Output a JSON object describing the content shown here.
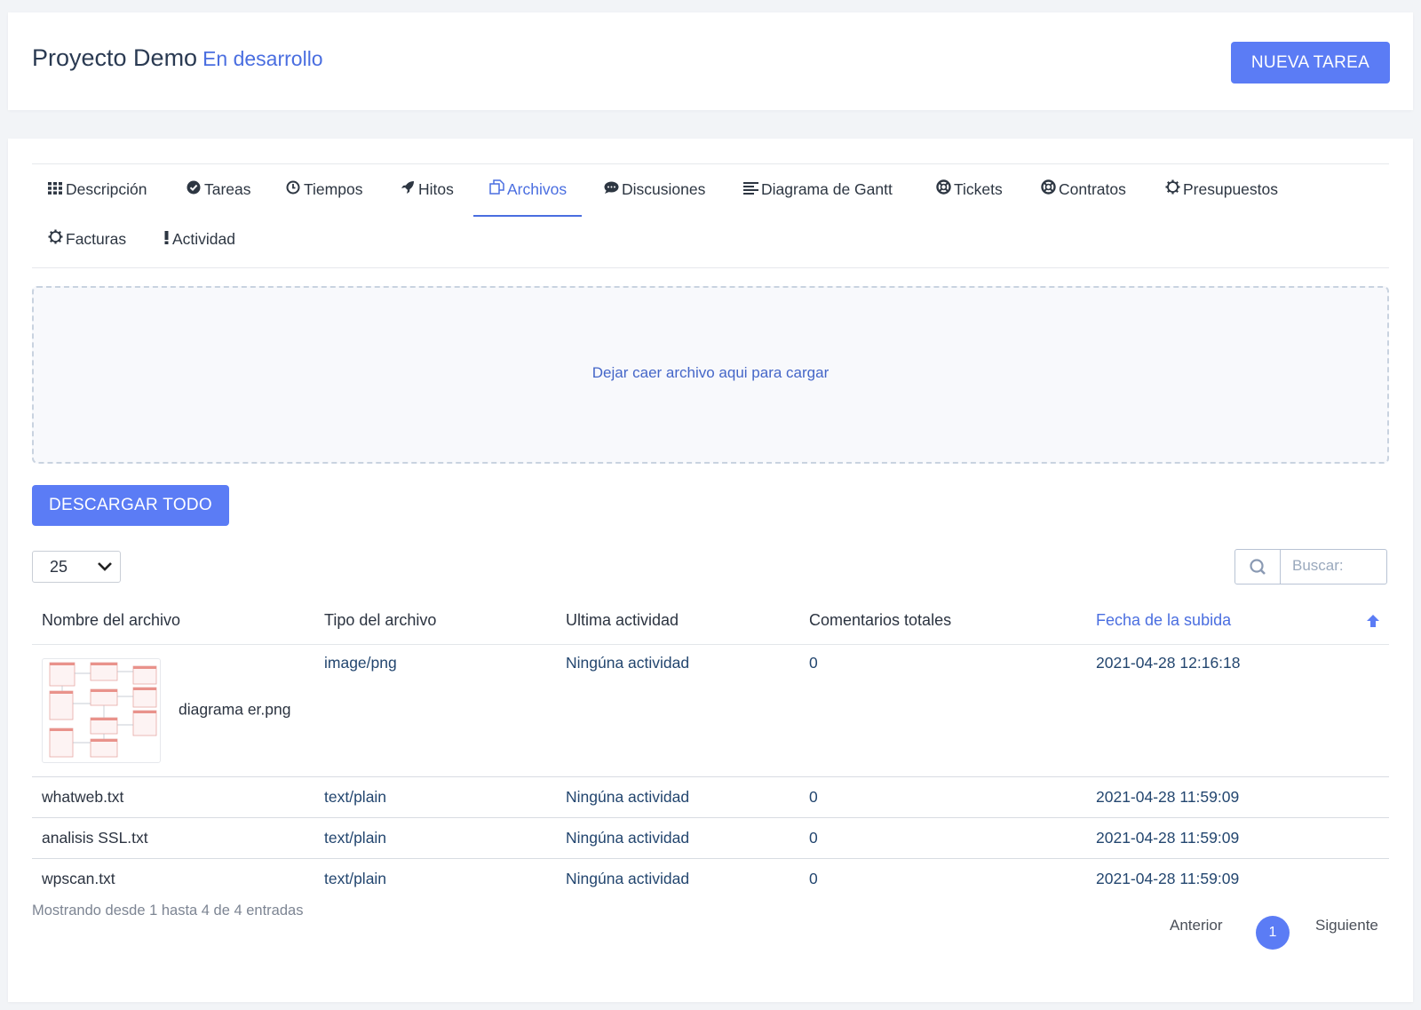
{
  "header": {
    "title": "Proyecto Demo",
    "status": "En desarrollo",
    "new_task_label": "NUEVA TAREA"
  },
  "tabs": [
    {
      "label": "Descripción",
      "icon": "grid-icon"
    },
    {
      "label": "Tareas",
      "icon": "check-circle-icon"
    },
    {
      "label": "Tiempos",
      "icon": "clock-icon"
    },
    {
      "label": "Hitos",
      "icon": "rocket-icon"
    },
    {
      "label": "Archivos",
      "icon": "files-icon",
      "active": true
    },
    {
      "label": "Discusiones",
      "icon": "comment-icon"
    },
    {
      "label": "Diagrama de Gantt",
      "icon": "align-left-icon"
    },
    {
      "label": "Tickets",
      "icon": "life-ring-icon"
    },
    {
      "label": "Contratos",
      "icon": "life-ring-icon"
    },
    {
      "label": "Presupuestos",
      "icon": "gear-icon"
    },
    {
      "label": "Facturas",
      "icon": "gear-icon"
    },
    {
      "label": "Actividad",
      "icon": "exclamation-icon"
    }
  ],
  "dropzone": {
    "text": "Dejar caer archivo aqui para cargar"
  },
  "download_all_label": "DESCARGAR TODO",
  "page_size": "25",
  "search": {
    "placeholder": "Buscar:"
  },
  "table": {
    "columns": [
      "Nombre del archivo",
      "Tipo del archivo",
      "Ultima actividad",
      "Comentarios totales",
      "Fecha de la subida"
    ],
    "rows": [
      {
        "name": "diagrama er.png",
        "type": "image/png",
        "activity": "Ningúna actividad",
        "comments": "0",
        "date": "2021-04-28 12:16:18"
      },
      {
        "name": "whatweb.txt",
        "type": "text/plain",
        "activity": "Ningúna actividad",
        "comments": "0",
        "date": "2021-04-28 11:59:09"
      },
      {
        "name": "analisis SSL.txt",
        "type": "text/plain",
        "activity": "Ningúna actividad",
        "comments": "0",
        "date": "2021-04-28 11:59:09"
      },
      {
        "name": "wpscan.txt",
        "type": "text/plain",
        "activity": "Ningúna actividad",
        "comments": "0",
        "date": "2021-04-28 11:59:09"
      }
    ]
  },
  "info": "Mostrando desde 1 hasta 4 de 4 entradas",
  "pagination": {
    "prev": "Anterior",
    "current": "1",
    "next": "Siguiente"
  },
  "colors": {
    "accent": "#5b7cf5",
    "link": "#4a6ee0"
  }
}
